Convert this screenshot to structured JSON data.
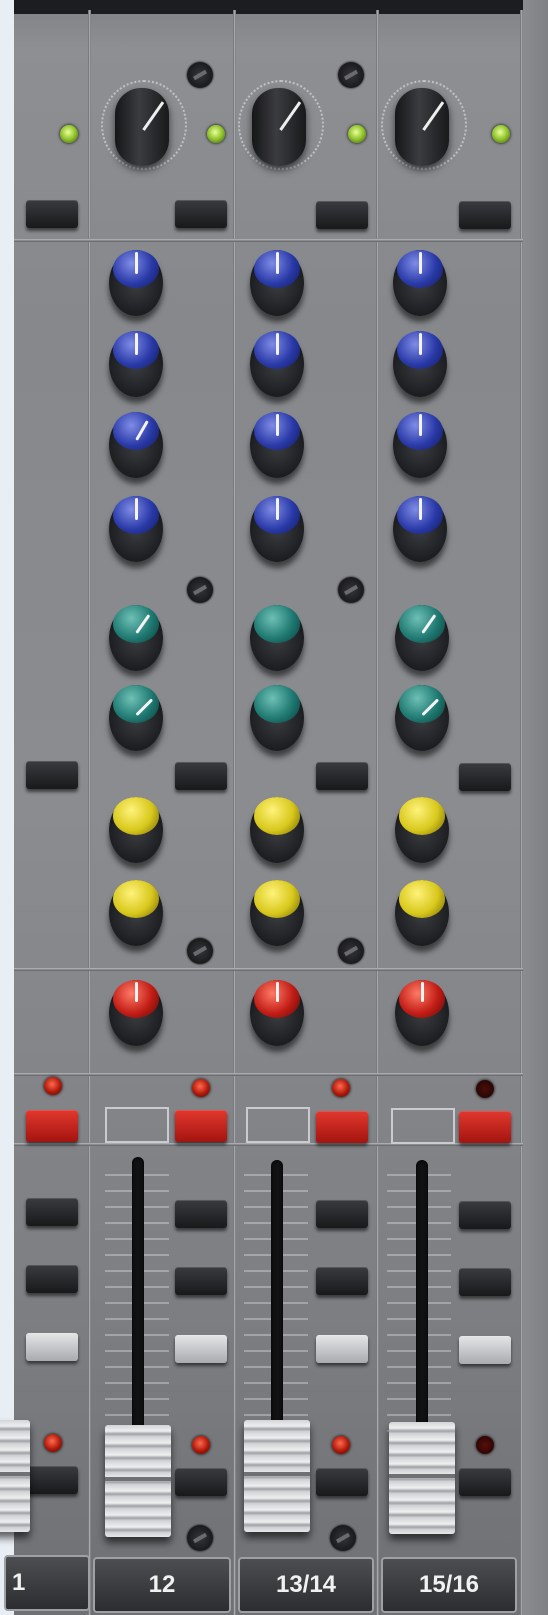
{
  "channel_labels": [
    "1",
    "12",
    "13/14",
    "15/16"
  ],
  "colors": {
    "panel": "#8a8c90",
    "eq_blue": "#2a3aa8",
    "aux_teal": "#1f7a72",
    "fx_yellow": "#d8c81c",
    "pan_red": "#c21d16",
    "mute_red": "#c2221a",
    "signal_led": "#9fd030"
  },
  "icons": [
    "gain-knob",
    "signal-led",
    "screw",
    "eq-knob",
    "aux-knob",
    "fx-knob",
    "pan-knob",
    "mute-button",
    "fader"
  ]
}
